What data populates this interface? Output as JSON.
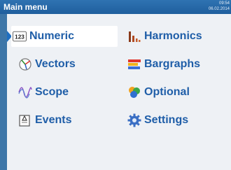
{
  "window": {
    "title": "Main menu",
    "time": "09:54",
    "date": "06.02.2014"
  },
  "menu": {
    "left": [
      {
        "label": "Numeric",
        "icon": "numeric-123-icon",
        "selected": true
      },
      {
        "label": "Vectors",
        "icon": "vectors-icon",
        "selected": false
      },
      {
        "label": "Scope",
        "icon": "scope-waveform-icon",
        "selected": false
      },
      {
        "label": "Events",
        "icon": "events-icon",
        "selected": false
      }
    ],
    "right": [
      {
        "label": "Harmonics",
        "icon": "harmonics-bars-icon"
      },
      {
        "label": "Bargraphs",
        "icon": "bargraphs-icon"
      },
      {
        "label": "Optional",
        "icon": "optional-puzzle-icon"
      },
      {
        "label": "Settings",
        "icon": "settings-gear-icon"
      }
    ]
  },
  "colors": {
    "frame": "#3d76a8",
    "titlebar": "#1f5f9e",
    "panel": "#eef1f5",
    "label": "#1f5ea8",
    "selection": "#ffffff"
  }
}
